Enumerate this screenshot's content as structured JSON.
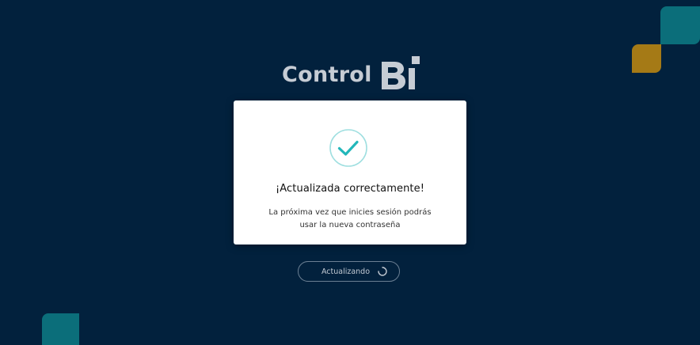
{
  "brand": {
    "logo_text": "Control",
    "logo_mark": "Bi"
  },
  "modal": {
    "icon": "check-circle-icon",
    "title": "¡Actualizada correctamente!",
    "message_line1": "La próxima vez que inicies sesión podrás",
    "message_line2": "usar la nueva contraseña"
  },
  "status_button": {
    "label": "Actualizando",
    "icon": "spinner-icon"
  },
  "colors": {
    "background": "#02213d",
    "accent_teal": "#0b6e7a",
    "accent_gold": "#a57a16",
    "check_teal": "#22b7ba"
  }
}
